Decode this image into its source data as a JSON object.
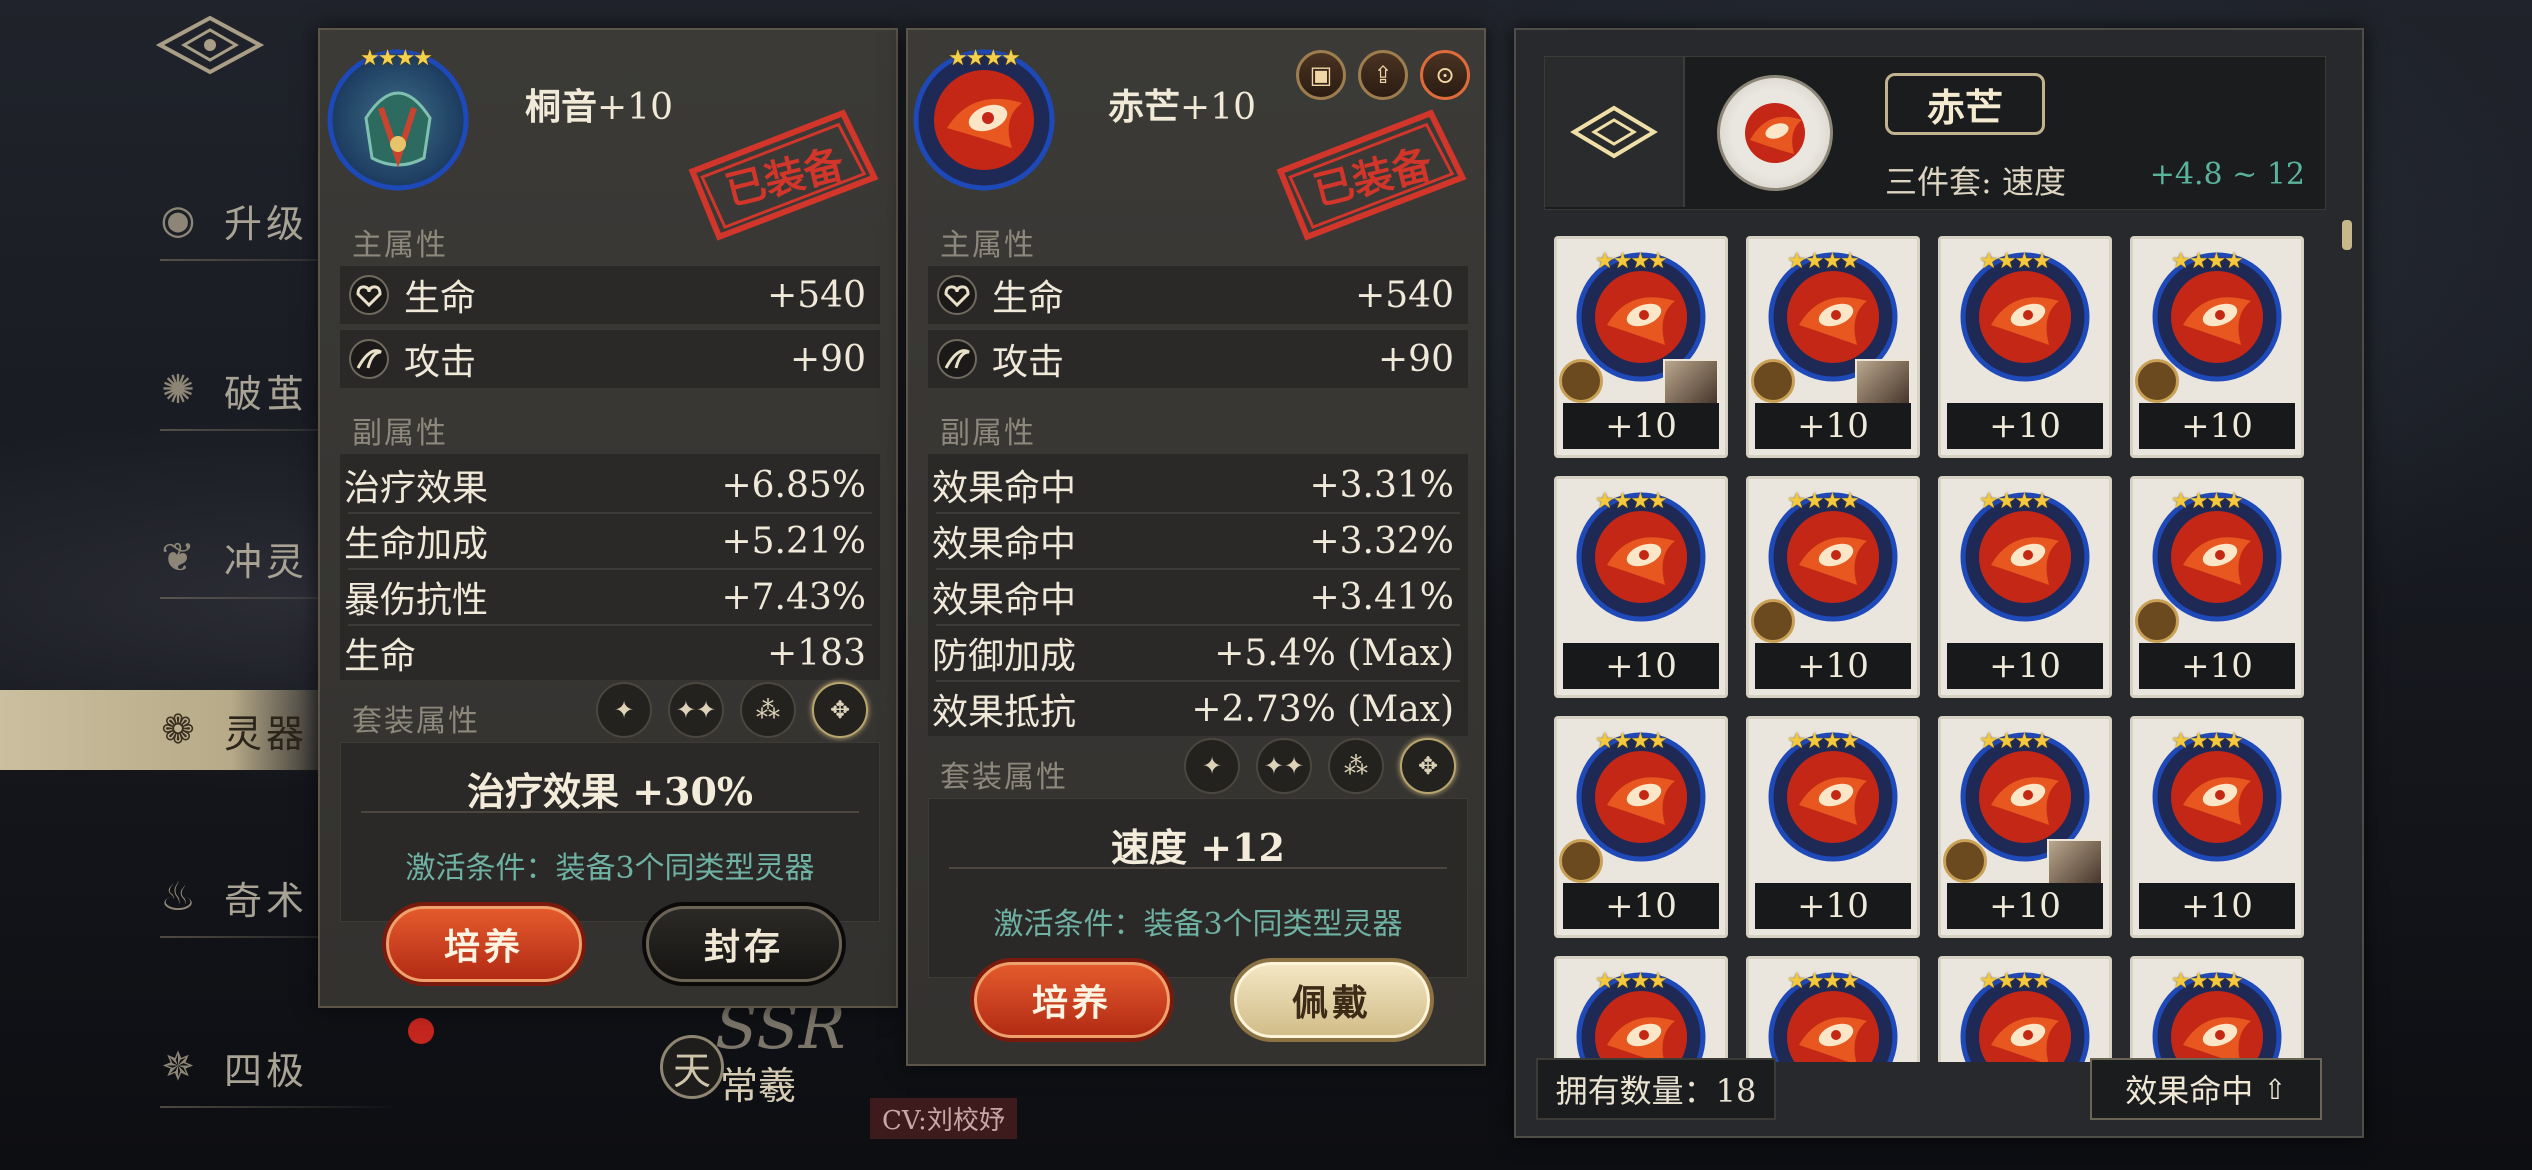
{
  "nav": {
    "items": [
      {
        "label": "升级",
        "active": false
      },
      {
        "label": "破茧",
        "active": false
      },
      {
        "label": "冲灵",
        "active": false
      },
      {
        "label": "灵器",
        "active": true
      },
      {
        "label": "奇术",
        "active": false
      },
      {
        "label": "四极",
        "active": false
      }
    ]
  },
  "character": {
    "rarity": "SSR",
    "badge": "天",
    "name": "常羲",
    "cv": "CV:刘校妤"
  },
  "left_item": {
    "name": "桐音",
    "level": "+10",
    "stamp": "已装备",
    "stars": "★★★★",
    "main_label": "主属性",
    "main_stats": [
      {
        "label": "生命",
        "value": "+540"
      },
      {
        "label": "攻击",
        "value": "+90"
      }
    ],
    "sub_label": "副属性",
    "sub_stats": [
      {
        "label": "治疗效果",
        "value": "+6.85%"
      },
      {
        "label": "生命加成",
        "value": "+5.21%"
      },
      {
        "label": "暴伤抗性",
        "value": "+7.43%"
      },
      {
        "label": "生命",
        "value": "+183"
      }
    ],
    "set_label": "套装属性",
    "set_effect": "治疗效果 +30%",
    "set_condition": "激活条件：装备3个同类型灵器",
    "btn_primary": "培养",
    "btn_secondary": "封存"
  },
  "right_item": {
    "name": "赤芒",
    "level": "+10",
    "stamp": "已装备",
    "stars": "★★★★",
    "main_label": "主属性",
    "main_stats": [
      {
        "label": "生命",
        "value": "+540"
      },
      {
        "label": "攻击",
        "value": "+90"
      }
    ],
    "sub_label": "副属性",
    "sub_stats": [
      {
        "label": "效果命中",
        "value": "+3.31%"
      },
      {
        "label": "效果命中",
        "value": "+3.32%"
      },
      {
        "label": "效果命中",
        "value": "+3.41%"
      },
      {
        "label": "防御加成",
        "value": "+5.4% (Max)"
      },
      {
        "label": "效果抵抗",
        "value": "+2.73% (Max)"
      }
    ],
    "set_label": "套装属性",
    "set_effect": "速度 +12",
    "set_condition": "激活条件：装备3个同类型灵器",
    "btn_primary": "培养",
    "btn_secondary": "佩戴"
  },
  "inventory": {
    "selected_name": "赤芒",
    "set_text": "三件套: 速度",
    "range_text": "+4.8 ~ 12",
    "owned_text": "拥有数量：18",
    "sort_text": "效果命中",
    "cards": [
      {
        "level": "+10",
        "stars": "★★★★",
        "locked": true,
        "portrait": true
      },
      {
        "level": "+10",
        "stars": "★★★★",
        "locked": true,
        "portrait": true
      },
      {
        "level": "+10",
        "stars": "★★★★",
        "locked": false,
        "portrait": false
      },
      {
        "level": "+10",
        "stars": "★★★★",
        "locked": true,
        "portrait": false
      },
      {
        "level": "+10",
        "stars": "★★★★",
        "locked": false,
        "portrait": false
      },
      {
        "level": "+10",
        "stars": "★★★★",
        "locked": true,
        "portrait": false
      },
      {
        "level": "+10",
        "stars": "★★★★",
        "locked": false,
        "portrait": false
      },
      {
        "level": "+10",
        "stars": "★★★★",
        "locked": true,
        "portrait": false
      },
      {
        "level": "+10",
        "stars": "★★★★",
        "locked": true,
        "portrait": false
      },
      {
        "level": "+10",
        "stars": "★★★★",
        "locked": false,
        "portrait": false
      },
      {
        "level": "+10",
        "stars": "★★★★",
        "locked": true,
        "portrait": true
      },
      {
        "level": "+10",
        "stars": "★★★★",
        "locked": false,
        "portrait": false
      },
      {
        "level": "",
        "stars": "★★★★",
        "locked": false,
        "portrait": false
      },
      {
        "level": "",
        "stars": "★★★★",
        "locked": false,
        "portrait": false
      },
      {
        "level": "",
        "stars": "★★★★",
        "locked": false,
        "portrait": false
      },
      {
        "level": "",
        "stars": "★★★★",
        "locked": false,
        "portrait": false
      }
    ]
  },
  "colors": {
    "accent_red": "#c9381c",
    "accent_gold": "#d2bd89",
    "accent_teal": "#5ab39b"
  }
}
